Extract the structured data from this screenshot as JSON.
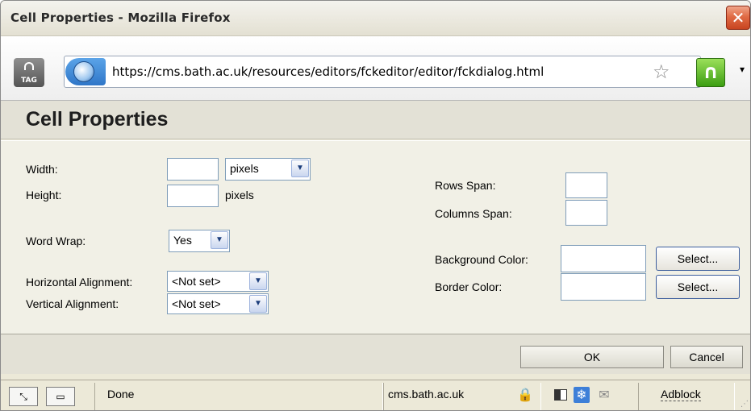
{
  "window": {
    "title": "Cell Properties - Mozilla Firefox",
    "close_glyph": "✕"
  },
  "urlbar": {
    "tag_label": "TAG",
    "url": "https://cms.bath.ac.uk/resources/editors/fckeditor/editor/fckdialog.html",
    "star_glyph": "☆",
    "addon_glyph": "∩",
    "dropdown_glyph": "▾"
  },
  "dialog": {
    "title": "Cell Properties",
    "width_label": "Width:",
    "width_value": "",
    "width_unit": "pixels",
    "height_label": "Height:",
    "height_value": "",
    "height_unit": "pixels",
    "wordwrap_label": "Word Wrap:",
    "wordwrap_value": "Yes",
    "halign_label": "Horizontal Alignment:",
    "halign_value": "<Not set>",
    "valign_label": "Vertical Alignment:",
    "valign_value": "<Not set>",
    "rowspan_label": "Rows Span:",
    "rowspan_value": "",
    "colspan_label": "Columns Span:",
    "colspan_value": "",
    "bgcolor_label": "Background Color:",
    "bgcolor_value": "",
    "bordercolor_label": "Border Color:",
    "bordercolor_value": "",
    "select_label": "Select...",
    "ok_label": "OK",
    "cancel_label": "Cancel",
    "arrow_glyph": "▼"
  },
  "statusbar": {
    "status_text": "Done",
    "domain": "cms.bath.ac.uk",
    "adblock": "Adblock",
    "lock_glyph": "🔒",
    "mail_glyph": "✉",
    "snow_glyph": "❄"
  }
}
